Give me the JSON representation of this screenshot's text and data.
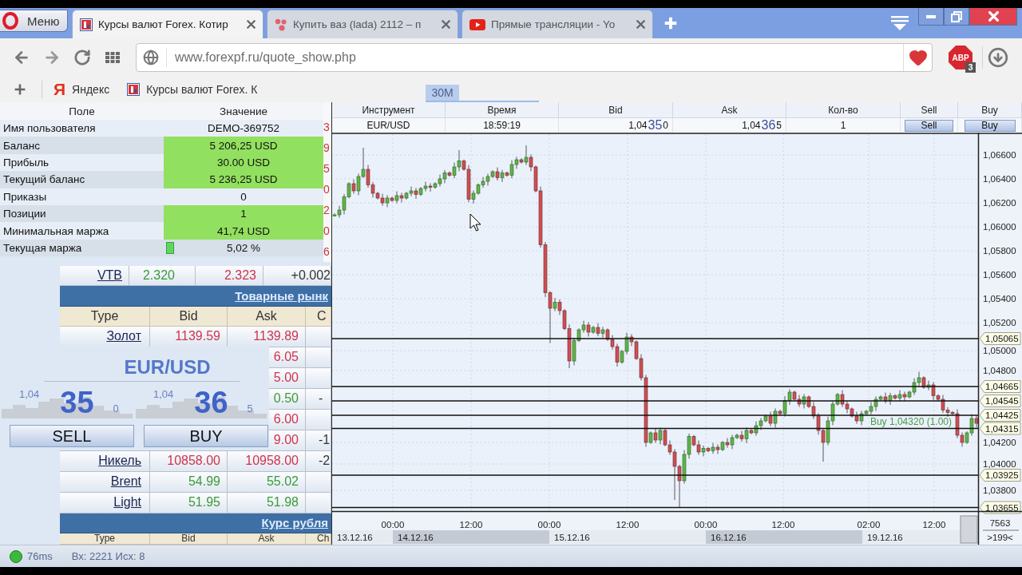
{
  "browser": {
    "menu_label": "Меню",
    "tabs": [
      {
        "title": "Курсы валют Forex. Котир",
        "kind": "forex",
        "selected": true
      },
      {
        "title": "Купить ваз (lada) 2112 – п",
        "kind": "dots",
        "selected": false
      },
      {
        "title": "Прямые трансляции - Yo",
        "kind": "video",
        "selected": false
      }
    ],
    "url": "www.forexpf.ru/quote_show.php",
    "bookmarked": true,
    "adblock_label": "ABP",
    "adblock_count": "3",
    "bookmarks": [
      {
        "kind": "yandex",
        "logo": "Я",
        "label": "Яндекс"
      },
      {
        "kind": "forex",
        "label": "Курсы валют Forex. К"
      }
    ]
  },
  "timeframe_tab": {
    "label": "30M",
    "selected": true
  },
  "account": {
    "columns": [
      "Поле",
      "Значение"
    ],
    "rows": [
      {
        "field": "Имя пользователя",
        "value": "DEMO-369752",
        "highlighted": false
      },
      {
        "field": "Баланс",
        "value": "5 206,25 USD",
        "highlighted": true
      },
      {
        "field": "Прибыль",
        "value": "30.00 USD",
        "highlighted": true
      },
      {
        "field": "Текущий баланс",
        "value": "5 236,25 USD",
        "highlighted": true
      },
      {
        "field": "Приказы",
        "value": "0",
        "highlighted": false
      },
      {
        "field": "Позиции",
        "value": "1",
        "highlighted": true
      },
      {
        "field": "Минимальная маржа",
        "value": "41,74 USD",
        "highlighted": true
      },
      {
        "field": "Текущая маржа",
        "value": "5,02 %",
        "highlighted": false,
        "level": 0.05
      }
    ],
    "edge_digits": [
      "3",
      "9",
      "5",
      "0",
      "2",
      "0",
      "6"
    ]
  },
  "quotes": {
    "rows": [
      {
        "kind": "stock",
        "name": "VTB",
        "bid": "2.320",
        "ask": "2.323",
        "change": "+0.002",
        "bid_up": true,
        "ask_up": false
      },
      {
        "kind": "section",
        "title": "Товарные рынк"
      },
      {
        "kind": "header",
        "cells": [
          "Type",
          "Bid",
          "Ask",
          "C"
        ]
      },
      {
        "kind": "quote",
        "name": "Золот",
        "bid": "1139.59",
        "ask": "1139.89",
        "bid_up": false,
        "ask_up": false
      },
      {
        "kind": "partial",
        "ask": "6.05",
        "ask_up": false
      },
      {
        "kind": "partial",
        "ask": "5.00",
        "ask_up": false
      },
      {
        "kind": "partial",
        "ask": "0.50",
        "ask_up": true,
        "change": "-"
      },
      {
        "kind": "partial",
        "ask": "6.00",
        "ask_up": false
      },
      {
        "kind": "partial",
        "ask": "9.00",
        "ask_up": false,
        "change": "-1"
      },
      {
        "kind": "quote",
        "name": "Никель",
        "bid": "10858.00",
        "ask": "10958.00",
        "change": "-2",
        "bid_up": false,
        "ask_up": false
      },
      {
        "kind": "quote",
        "name": "Brent",
        "bid": "54.99",
        "ask": "55.02",
        "bid_up": true,
        "ask_up": true
      },
      {
        "kind": "quote",
        "name": "Light",
        "bid": "51.95",
        "ask": "51.98",
        "bid_up": true,
        "ask_up": true
      },
      {
        "kind": "section",
        "title": "Курс рубля"
      },
      {
        "kind": "header",
        "cells": [
          "Type",
          "Bid",
          "Ask",
          "Ch"
        ]
      }
    ]
  },
  "trade_widget": {
    "symbol": "EUR/USD",
    "prices": [
      {
        "prefix": "1,04",
        "pips": "35",
        "fraction": "0"
      },
      {
        "prefix": "1,04",
        "pips": "36",
        "fraction": "5"
      }
    ],
    "buttons": [
      "SELL",
      "BUY"
    ]
  },
  "orders": {
    "columns": [
      "Инструмент",
      "Время",
      "Bid",
      "Ask",
      "Кол-во",
      "Sell",
      "Buy"
    ],
    "rows": [
      {
        "instrument": "EUR/USD",
        "time": "18:59:19",
        "bid": {
          "prefix": "1,04",
          "pips": "35",
          "fraction": "0"
        },
        "ask": {
          "prefix": "1,04",
          "pips": "36",
          "fraction": "5"
        },
        "quantity": "1",
        "sell": "Sell",
        "buy": "Buy"
      }
    ]
  },
  "chart": {
    "y_labels": [
      "1,06600",
      "1,06400",
      "1,06200",
      "1,06000",
      "1,05800",
      "1,05600",
      "1,05400",
      "1,05200",
      "1,05000",
      "1,04800",
      "1,04200",
      "1,04000",
      "1,03800"
    ],
    "level_tags": [
      "1,05065",
      "1,04665",
      "1,04545",
      "1,04425",
      "1,04315",
      "1,03925",
      "1,03655"
    ],
    "order_label": "Buy 1,04320 (1.00)",
    "time_labels": [
      "00:00",
      "12:00",
      "00:00",
      "12:00",
      "00:00",
      "12:00",
      "02:00",
      "12:00"
    ],
    "days": [
      {
        "label": "13.12.16",
        "shaded": false
      },
      {
        "label": "14.12.16",
        "shaded": true
      },
      {
        "label": "15.12.16",
        "shaded": false
      },
      {
        "label": "16.12.16",
        "shaded": true
      },
      {
        "label": "19.12.16",
        "shaded": false
      }
    ],
    "bar_count": "7563",
    "visible_range": ">199<"
  },
  "status_bar": {
    "connected": true,
    "latency": "76ms",
    "traffic": "Вх: 2221 Исх: 8"
  }
}
